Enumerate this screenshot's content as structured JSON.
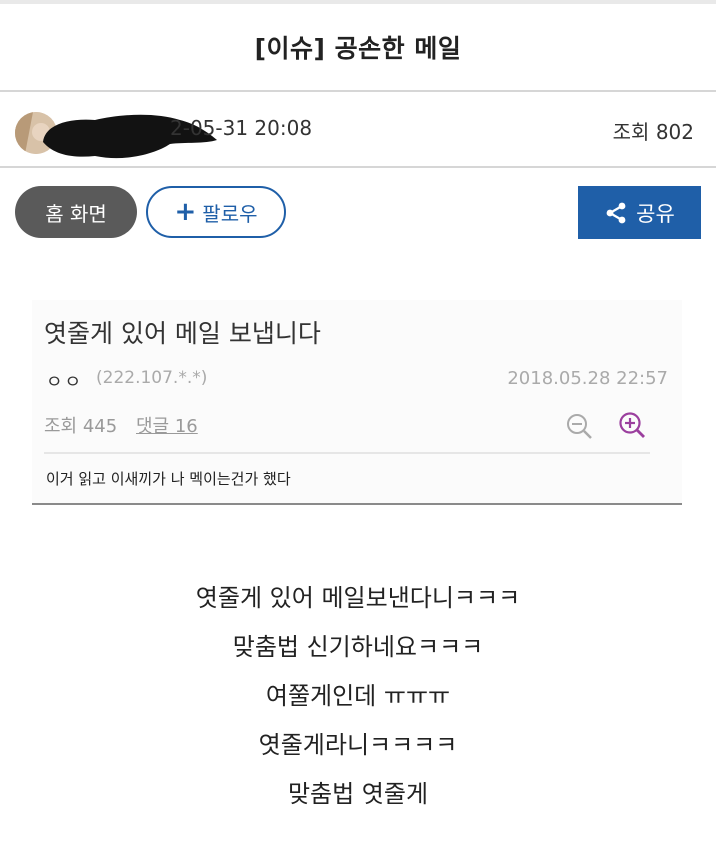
{
  "header": {
    "title": "[이슈] 공손한 메일"
  },
  "meta": {
    "datetime": "2-05-31 20:08",
    "views": "조회 802"
  },
  "actions": {
    "home_label": "홈 화면",
    "follow_plus": "+",
    "follow_label": "팔로우",
    "share_label": "공유"
  },
  "captured_post": {
    "title": "엿줄게 있어 메일 보냅니다",
    "author": "ㅇㅇ",
    "ip": "(222.107.*.*)",
    "date": "2018.05.28 22:57",
    "views": "조회 445",
    "replies": "댓글 16",
    "body": "이거 읽고 이새끼가 나 멕이는건가 했다"
  },
  "content": {
    "lines": [
      "엿줄게 있어 메일보낸다니ㅋㅋㅋ",
      "맞춤법 신기하네요ㅋㅋㅋ",
      "여쭐게인데 ㅠㅠㅠ",
      "엿줄게라니ㅋㅋㅋㅋ",
      "맞춤법 엿줄게"
    ]
  },
  "icons": {
    "share": "share-icon",
    "zoom_out": "zoom-out-icon",
    "zoom_in": "zoom-in-icon",
    "avatar": "avatar-image"
  },
  "colors": {
    "primary": "#1f5fa8",
    "home_button": "#5a5a5a",
    "zoom_in": "#9b3f9e"
  }
}
